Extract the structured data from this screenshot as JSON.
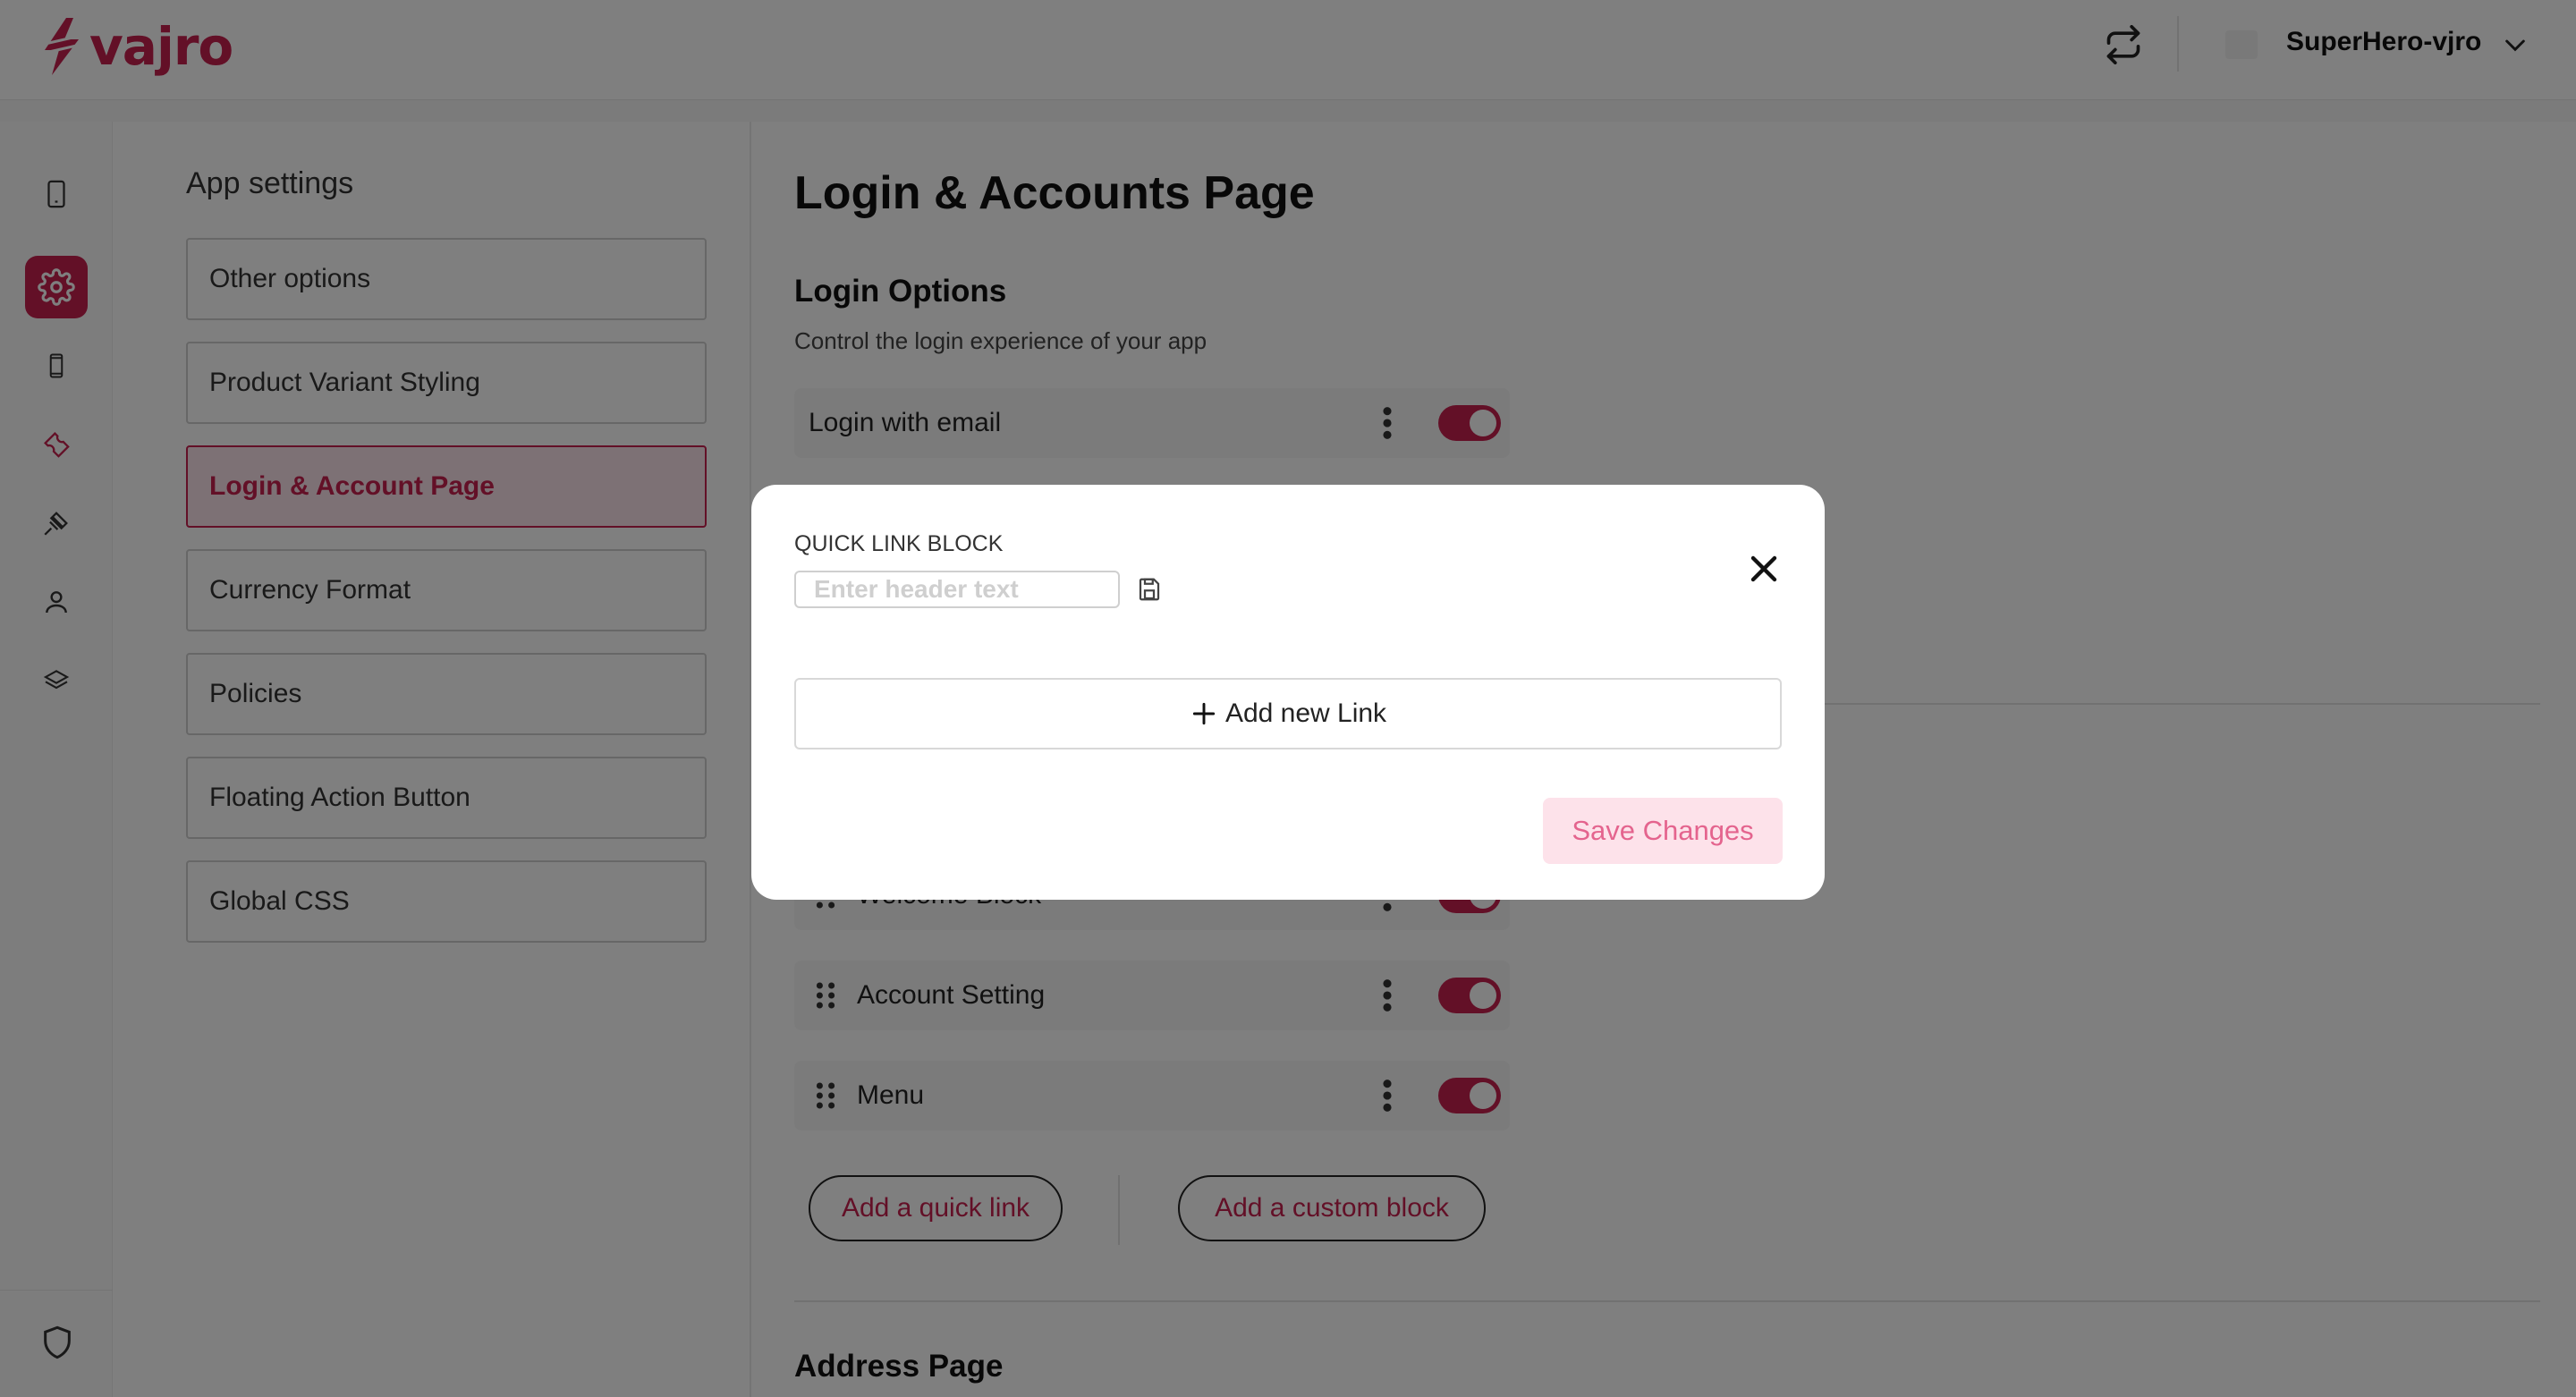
{
  "brand": {
    "name": "vajro",
    "accent": "#c6204f"
  },
  "header": {
    "store_name": "SuperHero-vjro",
    "sync_icon": "sync-icon",
    "dropdown_icon": "chevron-down-icon"
  },
  "rail": {
    "icons": [
      "phone-icon",
      "gear-icon",
      "mobile-icon",
      "wrench-icon",
      "plug-icon",
      "user-icon",
      "ticket-icon"
    ],
    "bottom_icon": "shield-icon"
  },
  "settings": {
    "title": "App settings",
    "items": [
      {
        "label": "Other options"
      },
      {
        "label": "Product Variant Styling"
      },
      {
        "label": "Login & Account Page",
        "active": true
      },
      {
        "label": "Currency Format"
      },
      {
        "label": "Policies"
      },
      {
        "label": "Floating Action Button"
      },
      {
        "label": "Global CSS"
      }
    ]
  },
  "main": {
    "title": "Login & Accounts Page",
    "login_options": {
      "title": "Login Options",
      "description": "Control the login experience of your app"
    },
    "rows": [
      {
        "label": "Login with email",
        "enabled": true
      },
      {
        "label": "Welcome Block",
        "enabled": true
      },
      {
        "label": "Account Setting",
        "enabled": true
      },
      {
        "label": "Menu",
        "enabled": true
      }
    ],
    "add_quick_link": "Add a quick link",
    "add_custom_block": "Add a custom block",
    "address_title": "Address Page"
  },
  "modal": {
    "label": "QUICK LINK BLOCK",
    "header_placeholder": "Enter header text",
    "add_link": "Add new Link",
    "save": "Save Changes"
  }
}
